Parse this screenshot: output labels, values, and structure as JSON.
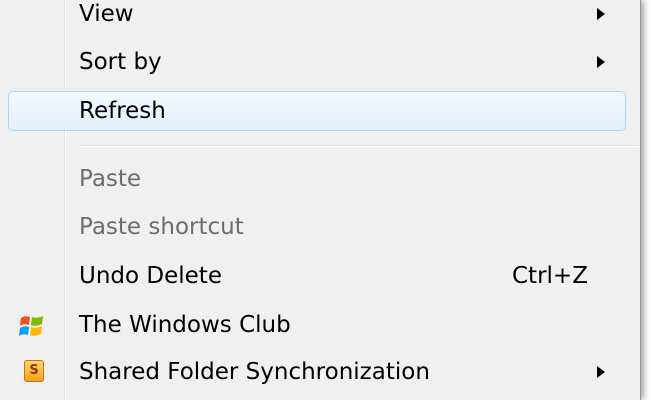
{
  "menu": {
    "items": [
      {
        "label": "View",
        "has_submenu": true,
        "disabled": false
      },
      {
        "label": "Sort by",
        "has_submenu": true,
        "disabled": false
      },
      {
        "label": "Refresh",
        "has_submenu": false,
        "disabled": false,
        "hovered": true
      },
      {
        "label": "Paste",
        "has_submenu": false,
        "disabled": true
      },
      {
        "label": "Paste shortcut",
        "has_submenu": false,
        "disabled": true
      },
      {
        "label": "Undo Delete",
        "shortcut": "Ctrl+Z",
        "has_submenu": false,
        "disabled": false
      },
      {
        "label": "The Windows Club",
        "icon": "windows-logo-icon",
        "has_submenu": false,
        "disabled": false
      },
      {
        "label": "Shared Folder Synchronization",
        "icon": "shared-folder-sync-icon",
        "icon_glyph": "S",
        "has_submenu": true,
        "disabled": false
      }
    ]
  },
  "colors": {
    "menu_background": "#f0f0f0",
    "hover_border": "#a8d8f5",
    "disabled_text": "#6d6d6d",
    "windows_logo": [
      "#f25022",
      "#7fba00",
      "#00a4ef",
      "#ffb900"
    ],
    "sync_icon": "#f6a21b"
  }
}
